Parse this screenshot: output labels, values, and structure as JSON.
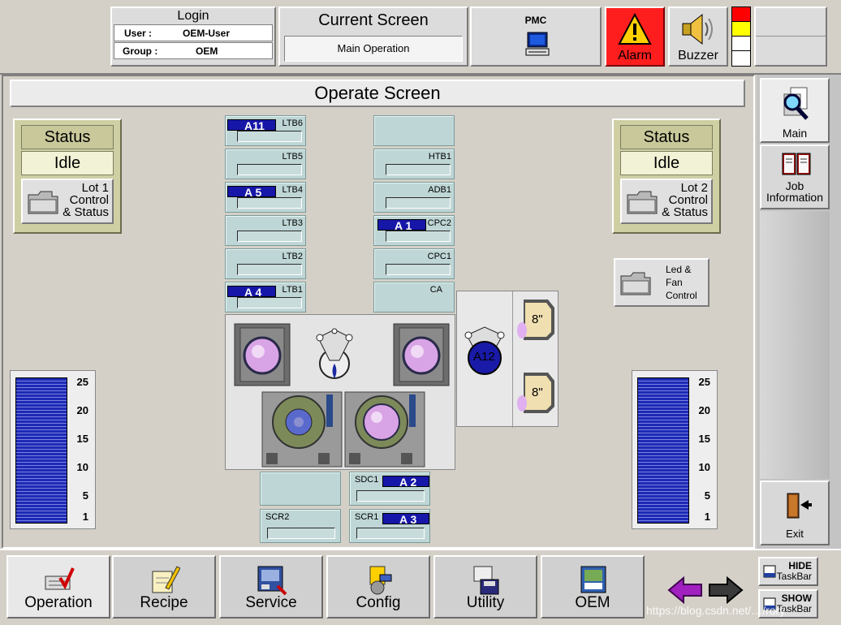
{
  "login": {
    "title": "Login",
    "user_label": "User  :",
    "user_value": "OEM-User",
    "group_label": "Group :",
    "group_value": "OEM"
  },
  "current_screen": {
    "title": "Current Screen",
    "value": "Main Operation"
  },
  "pmc": {
    "label": "PMC"
  },
  "alarm": {
    "label": "Alarm"
  },
  "buzzer": {
    "label": "Buzzer"
  },
  "signal_colors": [
    "#ff0000",
    "#ffff00",
    "#ffffff",
    "#ffffff"
  ],
  "page": {
    "title": "Operate Screen"
  },
  "left_status": {
    "heading": "Status",
    "value": "Idle",
    "button": "Lot 1\nControl\n& Status",
    "button_lines": [
      "Lot 1",
      "Control",
      "& Status"
    ]
  },
  "right_status": {
    "heading": "Status",
    "value": "Idle",
    "button_lines": [
      "Lot 2",
      "Control",
      "& Status"
    ]
  },
  "led_fan": {
    "lines": [
      "Led &",
      "Fan",
      "Control"
    ]
  },
  "left_stations": [
    {
      "label": "LTB6",
      "wafer": "A11"
    },
    {
      "label": "LTB5",
      "wafer": ""
    },
    {
      "label": "LTB4",
      "wafer": "A 5"
    },
    {
      "label": "LTB3",
      "wafer": ""
    },
    {
      "label": "LTB2",
      "wafer": ""
    },
    {
      "label": "LTB1",
      "wafer": "A 4"
    }
  ],
  "right_stations": [
    {
      "label": "",
      "wafer": ""
    },
    {
      "label": "HTB1",
      "wafer": ""
    },
    {
      "label": "ADB1",
      "wafer": ""
    },
    {
      "label": "CPC2",
      "wafer": "A 1"
    },
    {
      "label": "CPC1",
      "wafer": ""
    },
    {
      "label": "CA",
      "wafer": ""
    }
  ],
  "robot_wafer": "A12",
  "load_port_size": [
    "8\"",
    "8\""
  ],
  "lower_stations": [
    {
      "label": "",
      "wafer": ""
    },
    {
      "label": "SDC1",
      "wafer": "A  2"
    },
    {
      "label": "SCR2",
      "wafer": ""
    },
    {
      "label": "SCR1",
      "wafer": "A  3"
    }
  ],
  "gauge_ticks": [
    "25",
    "20",
    "15",
    "10",
    "5",
    "1"
  ],
  "left_gauge_level": 1.0,
  "right_gauge_level": 1.0,
  "sidebar": {
    "main": "Main",
    "job_info_lines": [
      "Job",
      "Information"
    ],
    "exit": "Exit"
  },
  "bottom_nav": [
    {
      "label": "Operation",
      "icon": "keyboard-check-icon"
    },
    {
      "label": "Recipe",
      "icon": "recipe-pencil-icon"
    },
    {
      "label": "Service",
      "icon": "service-machine-icon"
    },
    {
      "label": "Config",
      "icon": "config-tools-icon"
    },
    {
      "label": "Utility",
      "icon": "utility-disk-icon"
    },
    {
      "label": "OEM",
      "icon": "oem-book-icon"
    }
  ],
  "taskbar": {
    "hide_top": "HIDE",
    "hide_bottom": "TaskBar",
    "show_top": "SHOW",
    "show_bottom": "TaskBar"
  },
  "watermark": "https://blog.csdn.net/…/rory"
}
